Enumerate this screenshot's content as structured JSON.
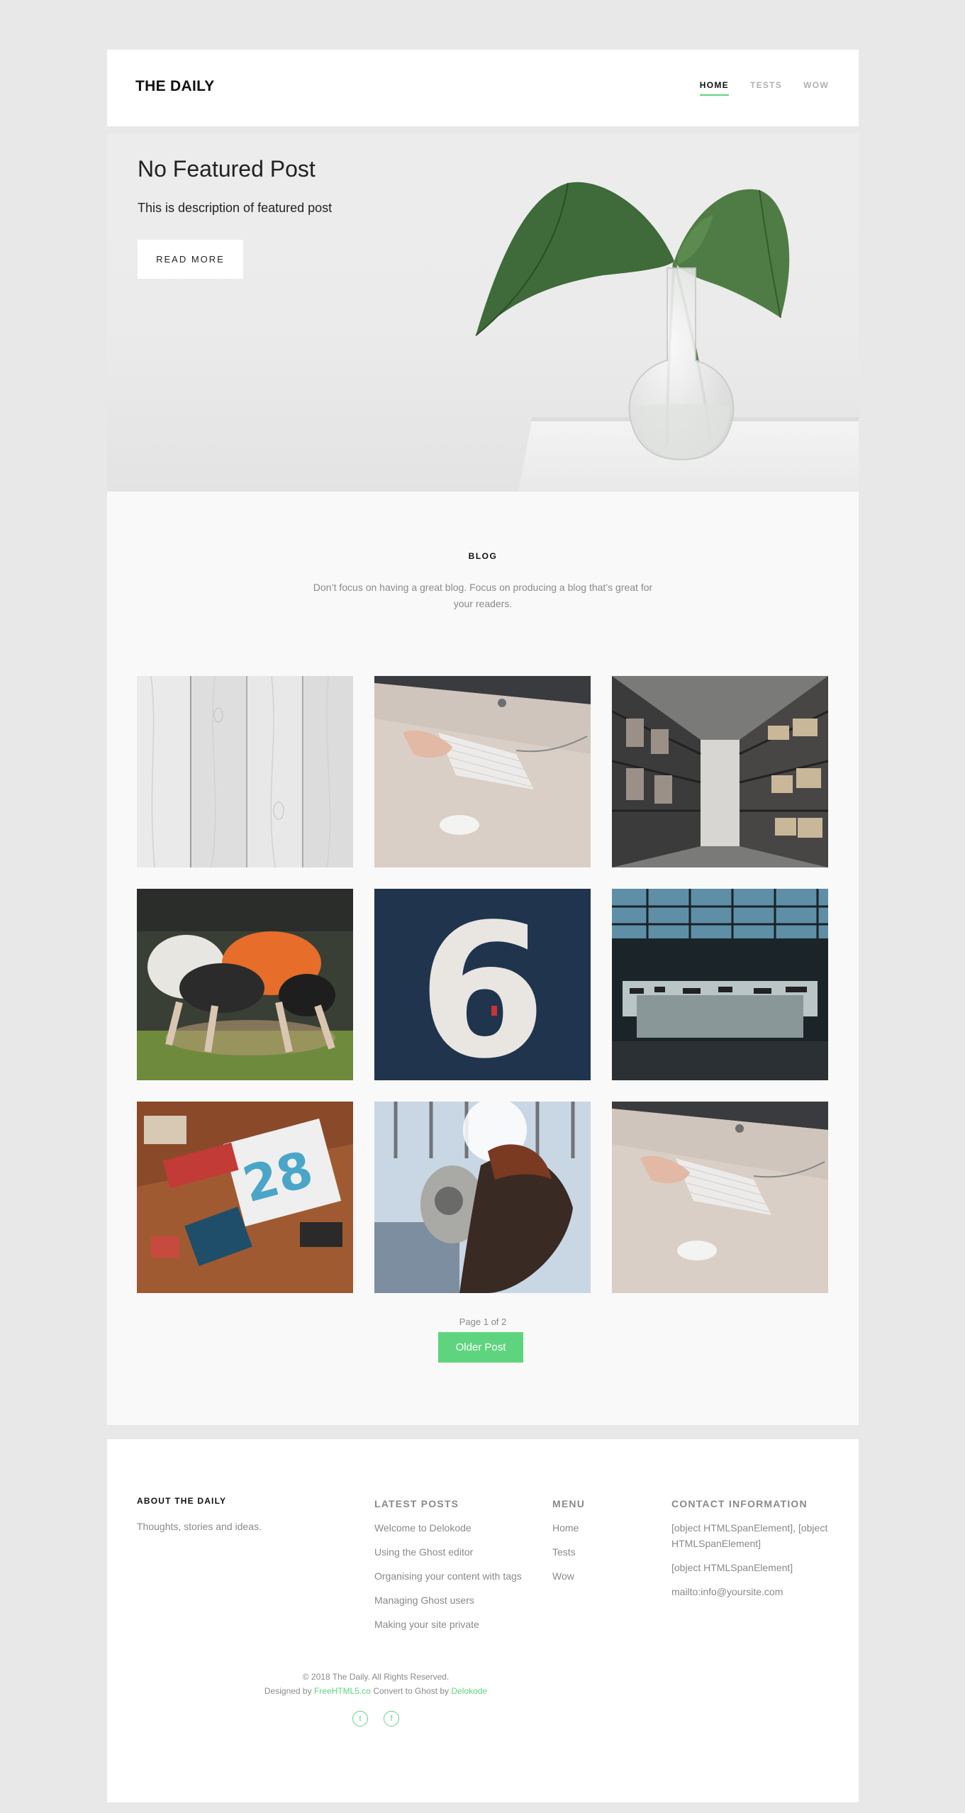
{
  "header": {
    "brand": "THE DAILY",
    "nav": [
      {
        "label": "HOME",
        "active": true
      },
      {
        "label": "TESTS",
        "active": false
      },
      {
        "label": "WOW",
        "active": false
      }
    ]
  },
  "hero": {
    "title": "No Featured Post",
    "description": "This is description of featured post",
    "button": "READ MORE",
    "image": "plant-in-glass-vase"
  },
  "blog": {
    "heading": "BLOG",
    "intro": "Don’t focus on having a great blog. Focus on producing a blog that’s great for your readers.",
    "posts": [
      {
        "image": "white-wood-planks"
      },
      {
        "image": "hands-on-keyboard-desk"
      },
      {
        "image": "archive-shelves"
      },
      {
        "image": "rugby-scrum"
      },
      {
        "image": "number-six-door"
      },
      {
        "image": "control-room"
      },
      {
        "image": "desk-flatlay"
      },
      {
        "image": "woman-binocular-viewer"
      },
      {
        "image": "hands-on-keyboard-desk"
      }
    ],
    "pagination": "Page 1 of 2",
    "older_button": "Older Post"
  },
  "footer": {
    "about": {
      "heading": "ABOUT THE DAILY",
      "text": "Thoughts, stories and ideas."
    },
    "latest": {
      "heading": "LATEST POSTS",
      "items": [
        "Welcome to Delokode",
        "Using the Ghost editor",
        "Organising your content with tags",
        "Managing Ghost users",
        "Making your site private"
      ]
    },
    "menu": {
      "heading": "MENU",
      "items": [
        "Home",
        "Tests",
        "Wow"
      ]
    },
    "contact": {
      "heading": "CONTACT INFORMATION",
      "items": [
        "[object HTMLSpanElement], [object HTMLSpanElement]",
        "[object HTMLSpanElement]",
        "mailto:info@yoursite.com"
      ]
    },
    "copyright": "© 2018 The Daily. All Rights Reserved.",
    "credit_prefix": "Designed by",
    "credit_link1": "FreeHTML5.co",
    "credit_middle": "Convert to Ghost by",
    "credit_link2": "Delokode",
    "social": [
      {
        "icon": "twitter-icon",
        "glyph": "t"
      },
      {
        "icon": "facebook-icon",
        "glyph": "f"
      }
    ],
    "accent_color": "#5fd47f"
  }
}
